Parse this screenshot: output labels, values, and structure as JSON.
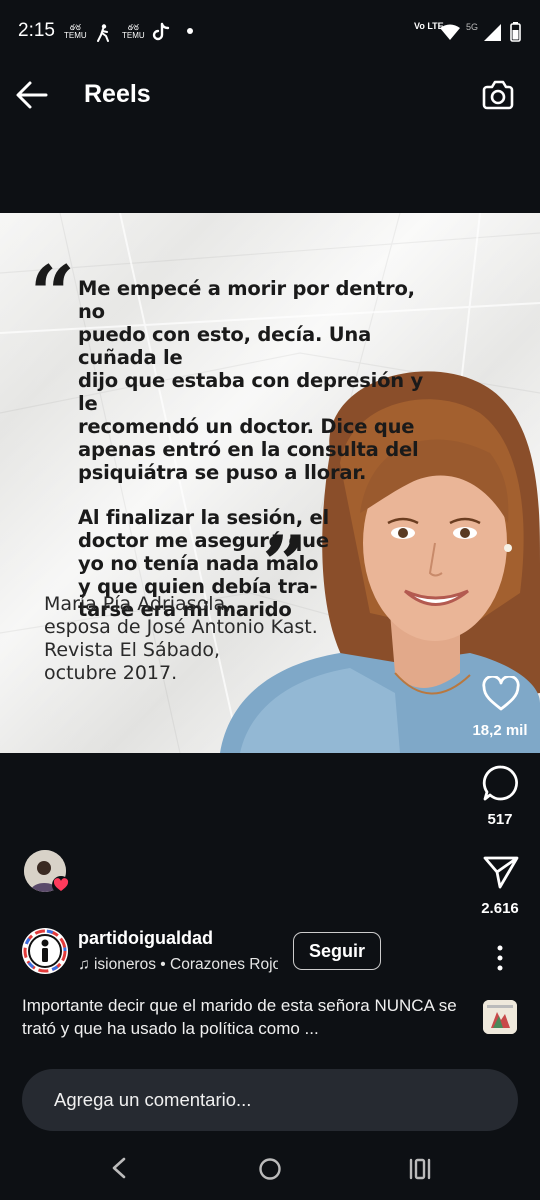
{
  "status": {
    "time": "2:15",
    "notif_icons": [
      "temu-icon",
      "walking-icon",
      "temu-icon",
      "tiktok-icon",
      "dot-icon"
    ],
    "temu_label": "TEMU",
    "network": "5G",
    "volte": "Vo LTE"
  },
  "header": {
    "title": "Reels"
  },
  "post": {
    "quote_open": "“",
    "quote_close": "”",
    "quote_para1": "Me empecé a morir por dentro, no\npuedo con esto, decía. Una cuñada le\ndijo que estaba con depresión y le\nrecomendó un doctor. Dice que\napenas entró en la consulta del\npsiquiátra se puso a llorar.",
    "quote_para2": "Al finalizar la sesión, el\ndoctor me aseguró que\nyo no tenía nada malo\ny que quien debía tra-\ntarse era mi marido",
    "attribution": "María Pía Adriasola,\nesposa de José Antonio Kast.\nRevista El Sábado,\noctubre 2017."
  },
  "actions": {
    "likes": "18,2 mil",
    "comments": "517",
    "shares": "2.616"
  },
  "author": {
    "username": "partidoigualdad",
    "music": "isioneros • Corazones Rojos",
    "follow_label": "Seguir"
  },
  "caption": "Importante decir que el marido de esta señora NUNCA se trató y que ha usado la política como ...",
  "comment_placeholder": "Agrega un comentario...",
  "colors": {
    "background": "#0d1014",
    "comment_bg": "#262a31",
    "like_badge": "#ff3b5c"
  }
}
